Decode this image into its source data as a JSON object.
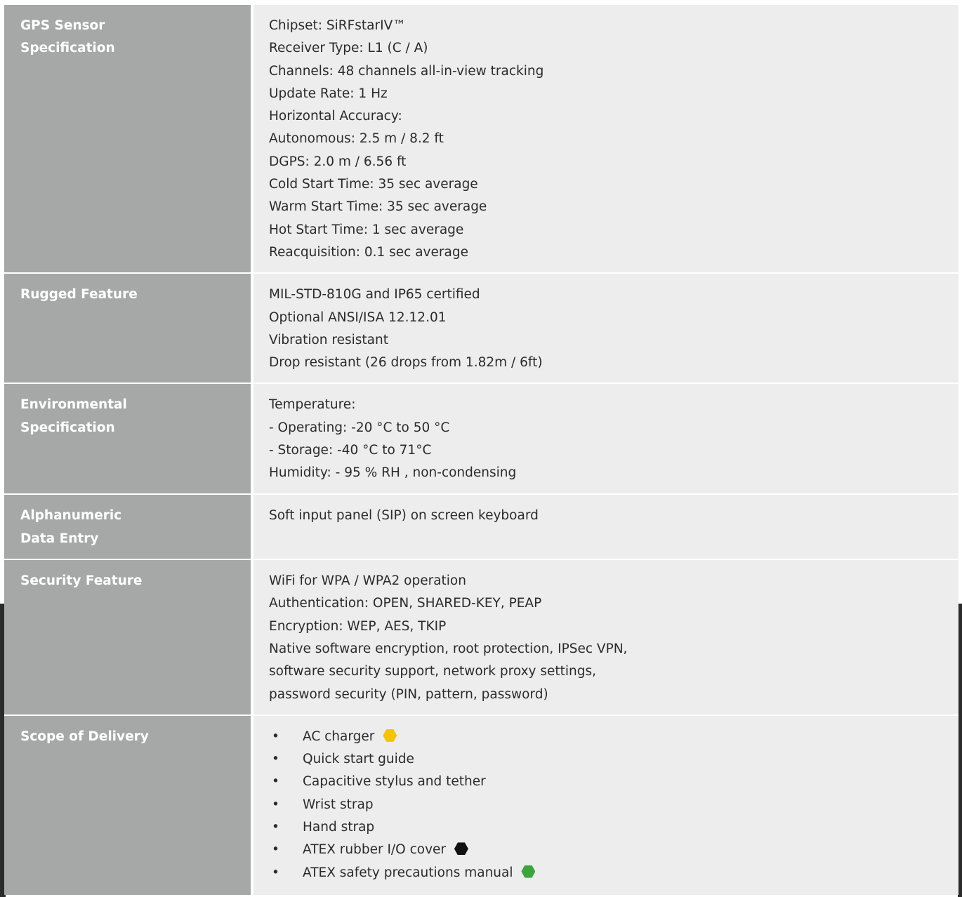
{
  "rows": [
    {
      "label": [
        "GPS Sensor",
        "Specification"
      ],
      "values": [
        "Chipset: SiRFstarIV™",
        "Receiver Type: L1 (C / A)",
        "Channels: 48 channels all-in-view tracking",
        "Update Rate: 1 Hz",
        "Horizontal Accuracy:",
        "Autonomous: 2.5 m / 8.2 ft",
        "DGPS: 2.0 m / 6.56 ft",
        "Cold Start Time: 35 sec average",
        "Warm Start Time: 35 sec average",
        "Hot Start Time: 1 sec average",
        "Reacquisition: 0.1 sec average"
      ]
    },
    {
      "label": [
        "Rugged Feature"
      ],
      "values": [
        "MIL-STD-810G and IP65 certified",
        "Optional ANSI/ISA 12.12.01",
        "Vibration resistant",
        "Drop resistant (26 drops from 1.82m / 6ft)"
      ]
    },
    {
      "label": [
        "Environmental",
        "Specification"
      ],
      "values": [
        "Temperature:",
        "- Operating: -20 °C to 50 °C",
        "- Storage: -40 °C to 71°C",
        "Humidity: - 95 % RH , non-condensing"
      ]
    },
    {
      "label": [
        "Alphanumeric",
        "Data Entry"
      ],
      "values": [
        "Soft input panel (SIP) on screen keyboard"
      ]
    },
    {
      "label": [
        "Security Feature"
      ],
      "values": [
        "WiFi for WPA / WPA2 operation",
        "Authentication: OPEN, SHARED-KEY, PEAP",
        "Encryption: WEP, AES, TKIP",
        "Native software encryption, root protection, IPSec VPN,",
        "software security support, network proxy settings,",
        "password security (PIN, pattern, password)"
      ]
    },
    {
      "label": [
        "Scope of Delivery"
      ],
      "bullet_symbol": "•",
      "items": [
        {
          "text": "AC charger",
          "marker_color": "#f5c400"
        },
        {
          "text": "Quick start guide"
        },
        {
          "text": "Capacitive stylus and tether"
        },
        {
          "text": "Wrist strap"
        },
        {
          "text": "Hand strap"
        },
        {
          "text": "ATEX rubber I/O cover",
          "marker_color": "#111111"
        },
        {
          "text": "ATEX safety precautions manual",
          "marker_color": "#3aa63a"
        }
      ]
    }
  ]
}
